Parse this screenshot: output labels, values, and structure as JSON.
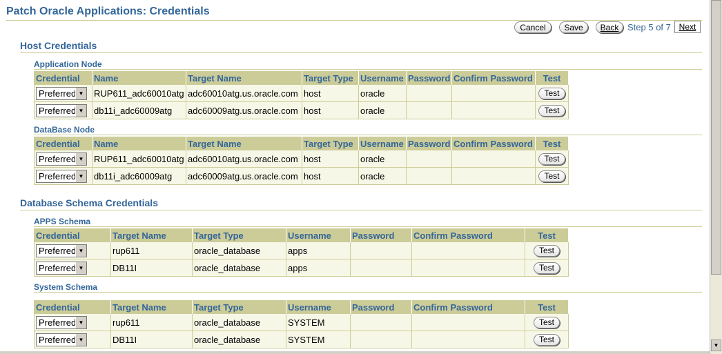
{
  "page_title": "Patch Oracle Applications: Credentials",
  "nav": {
    "cancel": "Cancel",
    "save": "Save",
    "back": "Back",
    "step": "Step 5 of 7",
    "next": "Next"
  },
  "host_credentials": {
    "title": "Host Credentials",
    "columns": [
      "Credential",
      "Name",
      "Target Name",
      "Target Type",
      "Username",
      "Password",
      "Confirm Password",
      "Test"
    ],
    "application_node": {
      "title": "Application Node",
      "rows": [
        {
          "credential": "Preferred",
          "name": "RUP611_adc60010atg",
          "target_name": "adc60010atg.us.oracle.com",
          "target_type": "host",
          "username": "oracle",
          "password": "",
          "confirm_password": "",
          "test": "Test"
        },
        {
          "credential": "Preferred",
          "name": "db11i_adc60009atg",
          "target_name": "adc60009atg.us.oracle.com",
          "target_type": "host",
          "username": "oracle",
          "password": "",
          "confirm_password": "",
          "test": "Test"
        }
      ]
    },
    "database_node": {
      "title": "DataBase Node",
      "rows": [
        {
          "credential": "Preferred",
          "name": "RUP611_adc60010atg",
          "target_name": "adc60010atg.us.oracle.com",
          "target_type": "host",
          "username": "oracle",
          "password": "",
          "confirm_password": "",
          "test": "Test"
        },
        {
          "credential": "Preferred",
          "name": "db11i_adc60009atg",
          "target_name": "adc60009atg.us.oracle.com",
          "target_type": "host",
          "username": "oracle",
          "password": "",
          "confirm_password": "",
          "test": "Test"
        }
      ]
    }
  },
  "db_schema_credentials": {
    "title": "Database Schema Credentials",
    "columns": [
      "Credential",
      "Target Name",
      "Target Type",
      "Username",
      "Password",
      "Confirm Password",
      "Test"
    ],
    "apps_schema": {
      "title": "APPS Schema",
      "rows": [
        {
          "credential": "Preferred",
          "target_name": "rup611",
          "target_type": "oracle_database",
          "username": "apps",
          "password": "",
          "confirm_password": "",
          "test": "Test"
        },
        {
          "credential": "Preferred",
          "target_name": "DB11I",
          "target_type": "oracle_database",
          "username": "apps",
          "password": "",
          "confirm_password": "",
          "test": "Test"
        }
      ]
    },
    "system_schema": {
      "title": "System Schema",
      "rows": [
        {
          "credential": "Preferred",
          "target_name": "rup611",
          "target_type": "oracle_database",
          "username": "SYSTEM",
          "password": "",
          "confirm_password": "",
          "test": "Test"
        },
        {
          "credential": "Preferred",
          "target_name": "DB11I",
          "target_type": "oracle_database",
          "username": "SYSTEM",
          "password": "",
          "confirm_password": "",
          "test": "Test"
        }
      ]
    }
  },
  "icons": {
    "dropdown": "chevron-down-icon",
    "scroll_down": "scroll-down-arrow-icon"
  },
  "colors": {
    "heading": "#336699",
    "header_bg": "#cccc99",
    "row_bg": "#f7f7e7"
  }
}
